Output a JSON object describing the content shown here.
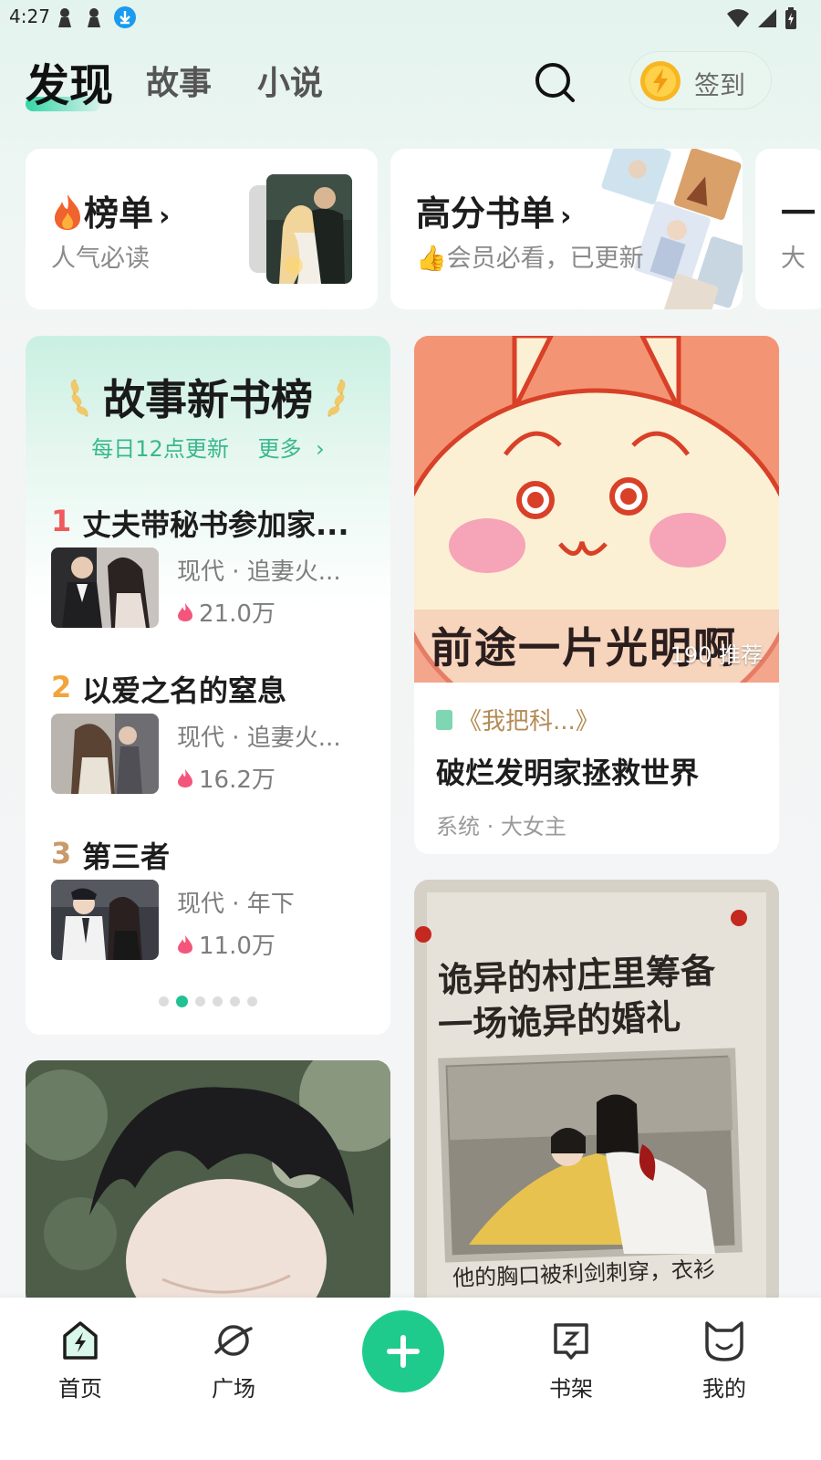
{
  "status_bar": {
    "time": "4:27"
  },
  "header": {
    "tabs": [
      {
        "label": "发现",
        "active": true
      },
      {
        "label": "故事",
        "active": false
      },
      {
        "label": "小说",
        "active": false
      }
    ],
    "checkin_label": "签到"
  },
  "categories": [
    {
      "title": "榜单",
      "subtitle": "人气必读",
      "icon": "fire-icon"
    },
    {
      "title": "高分书单",
      "subtitle": "会员必看，已更新",
      "icon": "thumbs-up-icon"
    },
    {
      "title": "一",
      "subtitle": "大"
    }
  ],
  "story_list": {
    "title": "故事新书榜",
    "update_note": "每日12点更新",
    "more_label": "更多",
    "items": [
      {
        "rank": "1",
        "title": "丈夫带秘书参加家...",
        "tags": "现代 · 追妻火...",
        "heat": "21.0万"
      },
      {
        "rank": "2",
        "title": "以爱之名的窒息",
        "tags": "现代 · 追妻火...",
        "heat": "16.2万"
      },
      {
        "rank": "3",
        "title": "第三者",
        "tags": "现代 · 年下",
        "heat": "11.0万"
      }
    ],
    "page_count": 6,
    "active_page": 2
  },
  "feed": [
    {
      "cover_text": "前途一片光明啊",
      "recommend_count": "190 推荐",
      "book_name": "《我把科...》",
      "title": "破烂发明家拯救世界",
      "tags": "系统 · 大女主"
    },
    {
      "cover_headline_1": "诡异的村庄里筹备",
      "cover_headline_2": "一场诡异的婚礼",
      "cover_caption": "他的胸口被利剑刺穿，衣衫"
    }
  ],
  "bottom_nav": [
    {
      "label": "首页",
      "icon": "home-bolt-icon",
      "active": true
    },
    {
      "label": "广场",
      "icon": "planet-icon",
      "active": false
    },
    {
      "label": "",
      "icon": "plus-icon",
      "active": false
    },
    {
      "label": "书架",
      "icon": "bookshelf-icon",
      "active": false
    },
    {
      "label": "我的",
      "icon": "profile-cat-icon",
      "active": false
    }
  ],
  "colors": {
    "accent": "#1fcb8c",
    "rank1": "#ef5a5a",
    "rank2": "#f2a33a",
    "rank3": "#c99a6a"
  }
}
